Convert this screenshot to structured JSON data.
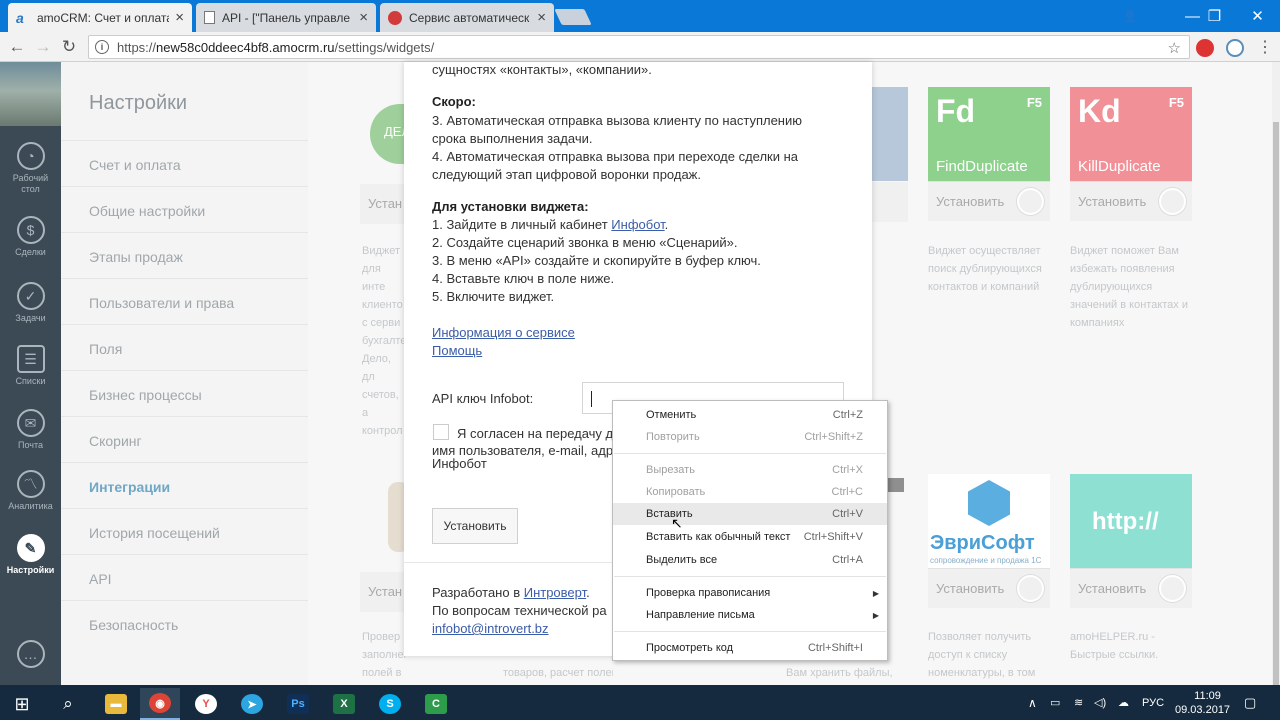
{
  "browser": {
    "tabs": [
      {
        "title": "amoCRM: Счет и оплата",
        "close": "×",
        "icon": "amocrm-icon"
      },
      {
        "title": "API - [\"Панель управле",
        "close": "×",
        "icon": "page-icon"
      },
      {
        "title": "Сервис автоматическ",
        "close": "×",
        "icon": "infobot-icon"
      }
    ],
    "url_prefix": "https://",
    "url_host": "new58c0ddeec4bf8.amocrm.ru",
    "url_path": "/settings/widgets/",
    "window_controls": {
      "user": "👤",
      "minimize": "—",
      "restore": "❐",
      "close": "✕"
    }
  },
  "leftnav": {
    "items": [
      {
        "label": "Рабочий стол",
        "icon": "dashboard-icon",
        "glyph": "◔"
      },
      {
        "label": "Сделки",
        "icon": "dollar-icon",
        "glyph": "$"
      },
      {
        "label": "Задачи",
        "icon": "check-icon",
        "glyph": "✓"
      },
      {
        "label": "Списки",
        "icon": "list-icon",
        "glyph": "☰"
      },
      {
        "label": "Почта",
        "icon": "mail-icon",
        "glyph": "✉"
      },
      {
        "label": "Аналитика",
        "icon": "analytics-icon",
        "glyph": "〽"
      },
      {
        "label": "Настройки",
        "icon": "settings-icon",
        "glyph": "✎",
        "active": true
      }
    ],
    "chat_glyph": "…"
  },
  "settings_menu": {
    "title": "Настройки",
    "items": [
      "Счет и оплата",
      "Общие настройки",
      "Этапы продаж",
      "Пользователи и права",
      "Поля",
      "Бизнес процессы",
      "Скоринг",
      "Интеграции",
      "История посещений",
      "API",
      "Безопасность"
    ],
    "active_index": 7
  },
  "widgets": {
    "cards": [
      {
        "big": "Fd",
        "f5": "F5",
        "name": "FindDuplicate",
        "install": "Установить",
        "color": "#8dd18d"
      },
      {
        "big": "Kd",
        "f5": "F5",
        "name": "KillDuplicate",
        "install": "Установить",
        "color": "#f19096"
      }
    ],
    "cards_bottom": [
      {
        "name": "ЭвриСофт",
        "sub": "сопровождение и продажа 1С",
        "install": "Установить"
      },
      {
        "name": "http://",
        "install": "Установить"
      }
    ],
    "descriptions": [
      "Виджет осуществляет поиск дублирующихся контактов и компаний",
      "Виджет поможет Вам избежать появления дублирующихся значений в контактах и компаниях",
      "Позволяет получить доступ к списку номенклатуры, в том",
      "amoHELPER.ru - Быстрые ссылки."
    ],
    "left_partial": {
      "install": "Устан",
      "install2": "Устан",
      "desc": "Виджет\nдля инте\nклиенто\nс серви\nбухгалте\nДело, дл\nсчетов, а\nконтрол",
      "desc2": "Провер\nзаполнение полей в\nкарточках.",
      "desc3": "Вам хранить файлы,",
      "desc4": "товаров, расчет полей",
      "logo_text": "ДЕЛ"
    }
  },
  "modal": {
    "line_top": "сущностях «контакты», «компании».",
    "soon_title": "Скоро:",
    "soon_lines": [
      "3. Автоматическая отправка вызова клиенту по наступлению",
      "срока выполнения задачи.",
      "4. Автоматическая отправка вызова при переходе сделки на",
      "следующий этап цифровой воронки продаж."
    ],
    "install_title": "Для установки виджета:",
    "install_step1_prefix": "1. Зайдите в личный кабинет ",
    "install_step1_link": "Инфобот",
    "install_step1_suffix": ".",
    "install_steps": [
      "2. Создайте сценарий звонка в меню «Сценарий».",
      "3. В меню «API» создайте и скопируйте в буфер ключ.",
      "4. Вставьте ключ в поле ниже.",
      "5. Включите виджет."
    ],
    "link_info": "Информация о сервисе",
    "link_help": "Помощь",
    "api_label": "API ключ Infobot:",
    "api_value": "",
    "consent_line1": "Я согласен на передачу д",
    "consent_line2": "имя пользователя, e-mail, адр",
    "consent_line3": "Инфобот",
    "install_button": "Установить",
    "dev_prefix": "Разработано в ",
    "dev_link": "Интроверт",
    "dev_suffix": ".",
    "support_text": "По вопросам технической ра",
    "support_email": "infobot@introvert.bz"
  },
  "context_menu": {
    "items": [
      {
        "label": "Отменить",
        "shortcut": "Ctrl+Z",
        "disabled": false
      },
      {
        "label": "Повторить",
        "shortcut": "Ctrl+Shift+Z",
        "disabled": true
      },
      {
        "label": "Вырезать",
        "shortcut": "Ctrl+X",
        "disabled": true
      },
      {
        "label": "Копировать",
        "shortcut": "Ctrl+C",
        "disabled": true
      },
      {
        "label": "Вставить",
        "shortcut": "Ctrl+V",
        "disabled": false,
        "hover": true
      },
      {
        "label": "Вставить как обычный текст",
        "shortcut": "Ctrl+Shift+V",
        "disabled": false
      },
      {
        "label": "Выделить все",
        "shortcut": "Ctrl+A",
        "disabled": false
      },
      {
        "label": "Проверка правописания",
        "shortcut": "",
        "submenu": true
      },
      {
        "label": "Направление письма",
        "shortcut": "",
        "submenu": true
      },
      {
        "label": "Просмотреть код",
        "shortcut": "Ctrl+Shift+I",
        "disabled": false
      }
    ]
  },
  "taskbar": {
    "apps": [
      {
        "name": "explorer",
        "glyph": "▬",
        "color": "#e8b93a"
      },
      {
        "name": "chrome",
        "glyph": "◉",
        "color": "#db4437",
        "active": true
      },
      {
        "name": "yandex",
        "glyph": "Y",
        "color": "#e84e4e"
      },
      {
        "name": "telegram",
        "glyph": "➤",
        "color": "#2ca5e0"
      },
      {
        "name": "photoshop",
        "glyph": "Ps",
        "color": "#0f2f57"
      },
      {
        "name": "excel",
        "glyph": "X",
        "color": "#1e7145"
      },
      {
        "name": "skype",
        "glyph": "S",
        "color": "#00aff0"
      },
      {
        "name": "app-c",
        "glyph": "C",
        "color": "#2e9d4b"
      }
    ],
    "lang": "РУС",
    "time": "11:09",
    "date": "09.03.2017"
  }
}
